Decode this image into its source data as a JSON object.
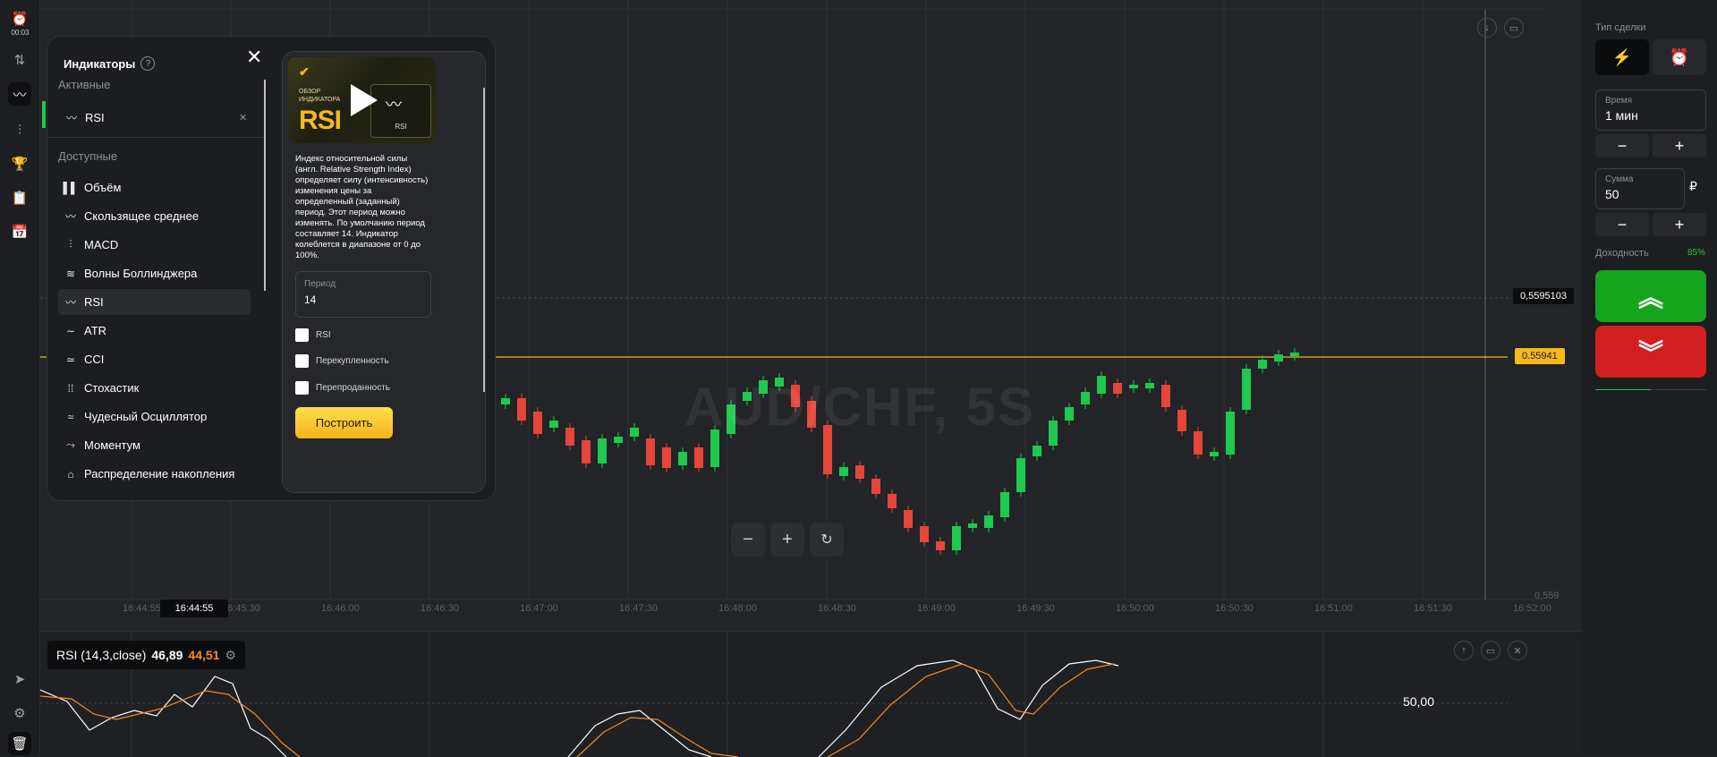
{
  "rail": {
    "time": "00:03"
  },
  "chart": {
    "watermark": "AUD/CHF, 5S",
    "time_labels": [
      "16:44:55",
      "16:45:30",
      "16:46:00",
      "16:46:30",
      "16:47:00",
      "16:47:30",
      "16:48:00",
      "16:48:30",
      "16:49:00",
      "16:49:30",
      "16:50:00",
      "16:50:30",
      "16:51:00",
      "16:51:30",
      "16:52:00"
    ],
    "crosshair_time": "16:44:55",
    "crosshair_price": "0,5595103",
    "current_price": "0.55941",
    "axis_price_low": "0,559",
    "line_color": "#f5b81d"
  },
  "rsi": {
    "label": "RSI (14,3,close)",
    "value1": "46,89",
    "value2": "44,51",
    "level": "50,00"
  },
  "right": {
    "trade_type_label": "Тип сделки",
    "time_label": "Время",
    "time_value": "1 мин",
    "sum_label": "Сумма",
    "sum_value": "50",
    "currency": "₽",
    "yield_label": "Доходность",
    "yield_value": "85%",
    "up_color": "#16a31d",
    "down_color": "#d11f1f"
  },
  "modal": {
    "title": "Индикаторы",
    "active_label": "Активные",
    "active_item": "RSI",
    "available_label": "Доступные",
    "items": [
      "Объём",
      "Скользящее среднее",
      "MACD",
      "Волны Боллинджера",
      "RSI",
      "ATR",
      "CCI",
      "Стохастик",
      "Чудесный Осциллятор",
      "Моментум",
      "Распределение накопления"
    ],
    "video": {
      "line1": "ОБЗОР",
      "line2": "ИНДИКАТОРА",
      "big": "RSI",
      "tag": "RSI"
    },
    "description": "Индекс относительной силы (англ. Relative Strength Index) определяет силу (интенсивность) изменения цены за определенный (заданный) период. Этот период можно изменять. По умолчанию период составляет 14. Индикатор колеблется в диапазоне от 0 до 100%.",
    "period_label": "Период",
    "period_value": "14",
    "checkboxes": [
      "RSI",
      "Перекупленность",
      "Перепроданность"
    ],
    "build_button": "Построить"
  }
}
